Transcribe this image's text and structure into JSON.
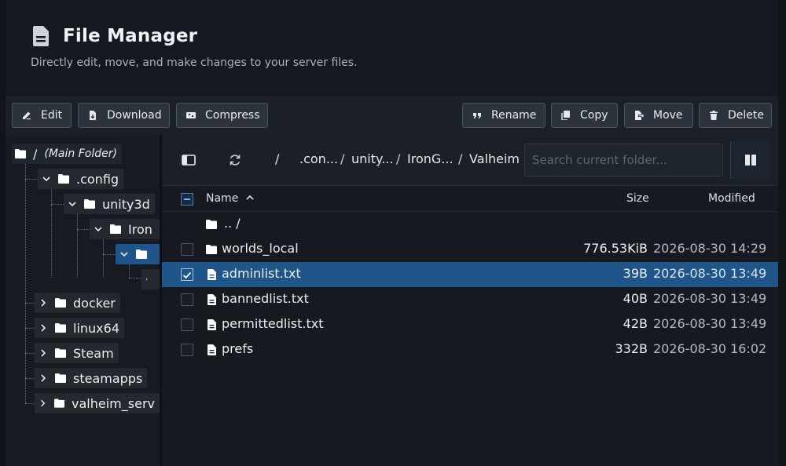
{
  "header": {
    "title": "File Manager",
    "subtitle": "Directly edit, move, and make changes to your server files."
  },
  "toolbar": {
    "edit": "Edit",
    "download": "Download",
    "compress": "Compress",
    "rename": "Rename",
    "copy": "Copy",
    "move": "Move",
    "delete": "Delete"
  },
  "tree": {
    "root_slash": "/",
    "root_label": "(Main Folder)",
    "config": ".config",
    "unity3d": "unity3d",
    "iron": "Iron",
    "docker": "docker",
    "linux64": "linux64",
    "steam": "Steam",
    "steamapps": "steamapps",
    "valheim_serv": "valheim_serv"
  },
  "path": {
    "root": "/",
    "c1": ".con...",
    "c2": "unity...",
    "c3": "IronG...",
    "c4": "Valheim",
    "sep": "/"
  },
  "search": {
    "placeholder": "Search current folder..."
  },
  "columns": {
    "name": "Name",
    "size": "Size",
    "modified": "Modified"
  },
  "files": [
    {
      "name": ".. /",
      "size": "",
      "modified": "",
      "type": "folder",
      "checkbox": false
    },
    {
      "name": "worlds_local",
      "size": "776.53KiB",
      "modified": "2026-08-30 14:29",
      "type": "folder",
      "checkbox": true
    },
    {
      "name": "adminlist.txt",
      "size": "39B",
      "modified": "2026-08-30 13:49",
      "type": "file",
      "checkbox": true,
      "selected": true
    },
    {
      "name": "bannedlist.txt",
      "size": "40B",
      "modified": "2026-08-30 13:49",
      "type": "file",
      "checkbox": true
    },
    {
      "name": "permittedlist.txt",
      "size": "42B",
      "modified": "2026-08-30 13:49",
      "type": "file",
      "checkbox": true
    },
    {
      "name": "prefs",
      "size": "332B",
      "modified": "2026-08-30 16:02",
      "type": "file",
      "checkbox": true
    }
  ],
  "colors": {
    "accent": "#1f5589",
    "background": "#111418",
    "panel": "#1b2027"
  }
}
